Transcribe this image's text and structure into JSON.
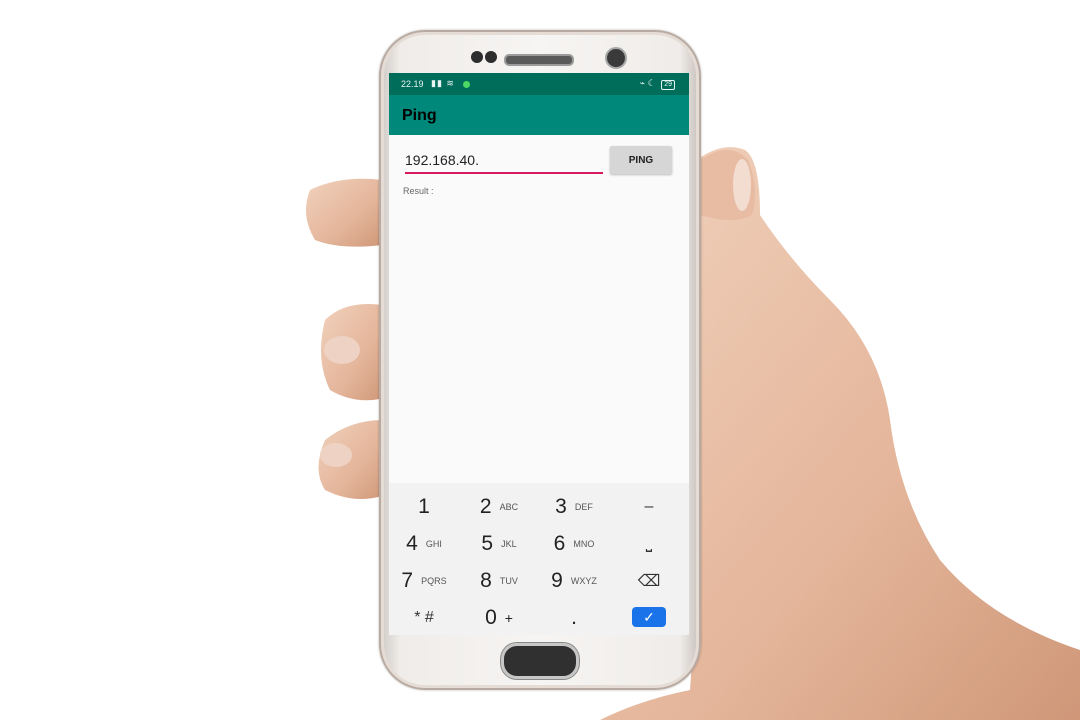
{
  "status_bar": {
    "time": "22.19",
    "signal_icons": "signal-icon wifi-icon",
    "notification_dot_color": "#4cd964",
    "right_icons": "vibrate-icon moon-icon",
    "battery": "29"
  },
  "app": {
    "title": "Ping",
    "toolbar_color": "#00897b",
    "statusbar_color": "#006d5b"
  },
  "form": {
    "ip_value": "192.168.40.",
    "ping_label": "PING",
    "result_label": "Result :"
  },
  "keyboard": {
    "keys": [
      {
        "num": "1",
        "sub": ""
      },
      {
        "num": "2",
        "sub": "ABC"
      },
      {
        "num": "3",
        "sub": "DEF"
      },
      {
        "num": "4",
        "sub": "GHI"
      },
      {
        "num": "5",
        "sub": "JKL"
      },
      {
        "num": "6",
        "sub": "MNO"
      },
      {
        "num": "7",
        "sub": "PQRS"
      },
      {
        "num": "8",
        "sub": "TUV"
      },
      {
        "num": "9",
        "sub": "WXYZ"
      },
      {
        "num": "* #",
        "sub": ""
      },
      {
        "num": "0",
        "sub": "+"
      },
      {
        "num": ".",
        "sub": ""
      }
    ],
    "minus": "–",
    "space": "⎵",
    "backspace": "⌫",
    "done": "✓",
    "done_color": "#1a73e8"
  }
}
